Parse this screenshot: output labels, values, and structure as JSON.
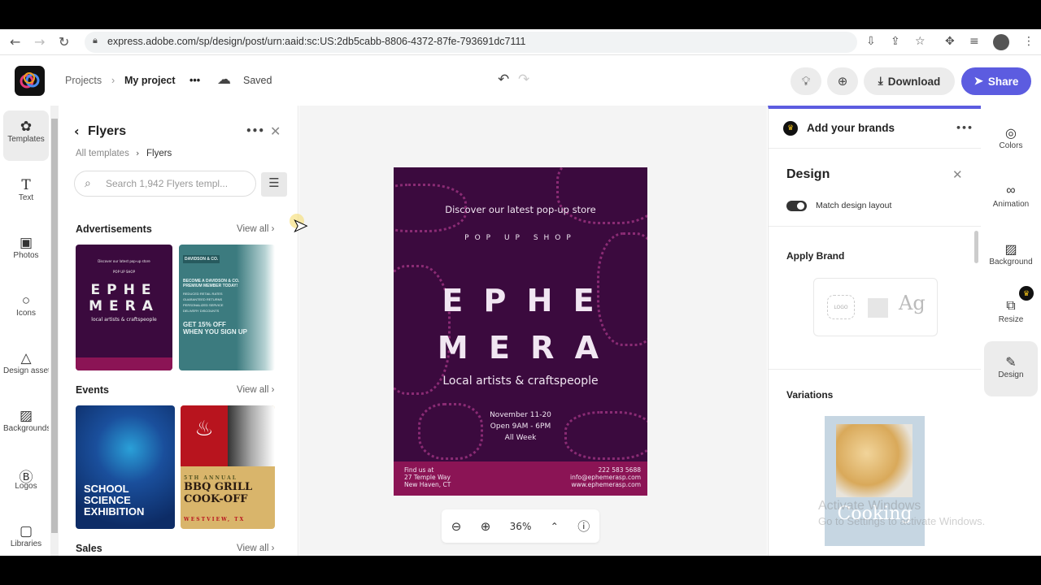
{
  "browser": {
    "url": "express.adobe.com/sp/design/post/urn:aaid:sc:US:2db5cabb-8806-4372-87fe-793691dc7111",
    "icons": [
      "back-icon",
      "forward-icon",
      "reload-icon",
      "lock-icon",
      "install-icon",
      "share-icon",
      "star-icon",
      "extensions-icon",
      "media-icon",
      "profile-avatar",
      "menu-icon"
    ]
  },
  "header": {
    "projects": "Projects",
    "project_name": "My project",
    "more": "•••",
    "status": "Saved",
    "download": "Download",
    "share": "Share"
  },
  "left_rail": {
    "items": [
      {
        "label": "Templates",
        "icon": "templates-icon",
        "active": true
      },
      {
        "label": "Text",
        "icon": "text-icon"
      },
      {
        "label": "Photos",
        "icon": "photos-icon"
      },
      {
        "label": "Icons",
        "icon": "icons-icon"
      },
      {
        "label": "Design assets",
        "icon": "design-assets-icon"
      },
      {
        "label": "Backgrounds",
        "icon": "backgrounds-icon"
      },
      {
        "label": "Logos",
        "icon": "logos-icon"
      },
      {
        "label": "Libraries",
        "icon": "libraries-icon"
      }
    ]
  },
  "panel": {
    "title": "Flyers",
    "more": "•••",
    "breadcrumb": [
      "All templates",
      "Flyers"
    ],
    "search_placeholder": "Search 1,942 Flyers templ...",
    "view_all": "View all",
    "sections": [
      {
        "title": "Advertisements",
        "thumbs": [
          {
            "lines": [
              "Discover our latest pop-up store",
              "POP UP SHOP",
              "EPHE",
              "MERA",
              "local artists & craftspeople"
            ]
          },
          {
            "lines": [
              "DAVIDSON & CO.",
              "BECOME A DAVIDSON & CO. PREMIUM MEMBER TODAY!",
              "REDUCED RETAIL RATES",
              "GUARANTEED RETURNS",
              "PERSONALIZED SERVICE",
              "DELIVERY DISCOUNTS",
              "GET 15% OFF",
              "WHEN YOU SIGN UP"
            ]
          }
        ]
      },
      {
        "title": "Events",
        "thumbs": [
          {
            "lines": [
              "SCHOOL",
              "SCIENCE",
              "EXHIBITION"
            ]
          },
          {
            "lines": [
              "5TH ANNUAL",
              "BBQ GRILL",
              "COOK-OFF",
              "WESTVIEW, TX"
            ]
          }
        ]
      },
      {
        "title": "Sales"
      }
    ]
  },
  "flyer": {
    "tagline": "Discover our latest pop-up store",
    "arc": "POP UP SHOP",
    "title_1": "E P H E",
    "title_2": "M E R A",
    "subtitle": "Local artists & craftspeople",
    "date": "November 11-20",
    "hours": "Open 9AM - 6PM",
    "week": "All Week",
    "address": [
      "Find us at",
      "27 Temple Way",
      "New Haven, CT"
    ],
    "contact": [
      "222 583 5688",
      "info@ephemerasp.com",
      "www.ephemerasp.com"
    ],
    "colors": {
      "background": "#3b0a3e",
      "footer": "#8b1455",
      "pattern": "#8a2b74"
    }
  },
  "zoom": {
    "level": "36%"
  },
  "design_panel": {
    "brands": "Add your brands",
    "more": "•••",
    "title": "Design",
    "toggle_label": "Match design layout",
    "toggle_on": true,
    "apply_brand": "Apply Brand",
    "logo_placeholder": "LOGO",
    "font_sample": "Ag",
    "variations": "Variations",
    "variation_title": "Cooking"
  },
  "right_rail": {
    "items": [
      {
        "label": "Colors",
        "icon": "palette-icon"
      },
      {
        "label": "Animation",
        "icon": "animation-icon"
      },
      {
        "label": "Background",
        "icon": "background-icon"
      },
      {
        "label": "Resize",
        "icon": "resize-icon",
        "premium": true
      },
      {
        "label": "Design",
        "icon": "magic-wand-icon",
        "active": true
      }
    ]
  },
  "watermark": {
    "line1": "Activate Windows",
    "line2": "Go to Settings to activate Windows."
  },
  "colors": {
    "accent": "#5c5ce0",
    "premium": "#f5c518"
  }
}
